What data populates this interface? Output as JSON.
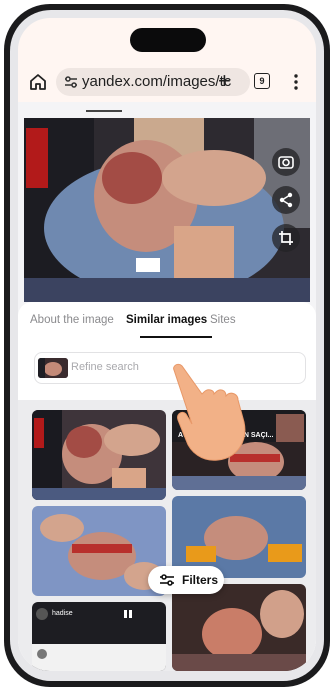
{
  "browser": {
    "url": "yandex.com/images/tc",
    "tab_count": "9"
  },
  "tabs": [
    {
      "label": "About the image",
      "active": false
    },
    {
      "label": "Similar images",
      "active": true
    },
    {
      "label": "Sites",
      "active": false
    }
  ],
  "search": {
    "placeholder": "Refine search"
  },
  "results": [
    {
      "caption": ""
    },
    {
      "caption": "AVUCUNDA AN... NIN SAÇI..."
    },
    {
      "caption": ""
    },
    {
      "caption": ""
    },
    {
      "caption": "hadise"
    },
    {
      "caption": ""
    }
  ],
  "filters_button": {
    "label": "Filters"
  },
  "icons": [
    "home-icon",
    "tune-icon",
    "plus-icon",
    "tabs-icon",
    "menu-icon",
    "lens-icon",
    "share-icon",
    "crop-icon",
    "filters-icon"
  ]
}
